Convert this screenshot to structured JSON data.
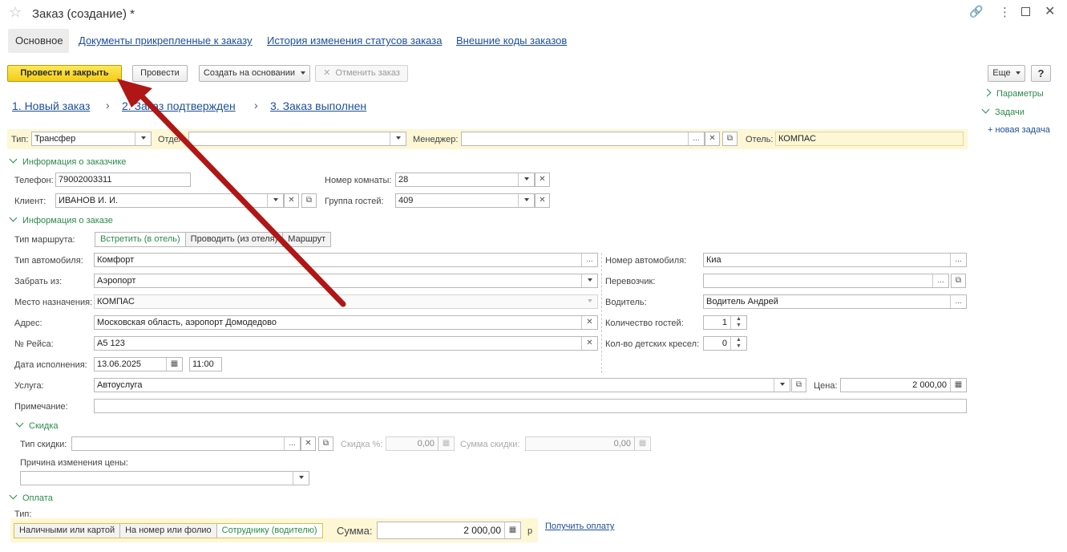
{
  "window": {
    "title": "Заказ (создание) *"
  },
  "tabs": [
    {
      "label": "Основное"
    },
    {
      "label": "Документы прикрепленные к заказу"
    },
    {
      "label": "История изменения статусов заказа"
    },
    {
      "label": "Внешние коды заказов"
    }
  ],
  "toolbar": {
    "post_close": "Провести и закрыть",
    "post": "Провести",
    "create_based": "Создать на основании",
    "cancel_order": "Отменить заказ",
    "more": "Еще",
    "help": "?"
  },
  "steps": [
    "1. Новый заказ",
    "2. Заказ подтвержден",
    "3. Заказ выполнен"
  ],
  "side_panel": {
    "params": "Параметры",
    "tasks": "Задачи",
    "new_task": "+ новая задача"
  },
  "header": {
    "type_label": "Тип:",
    "type_value": "Трансфер",
    "dept_label": "Отдел:",
    "dept_value": "",
    "manager_label": "Менеджер:",
    "manager_value": "",
    "hotel_label": "Отель:",
    "hotel_value": "КОМПАС"
  },
  "customer": {
    "section": "Информация о заказчике",
    "phone_label": "Телефон:",
    "phone_value": "79002003311",
    "client_label": "Клиент:",
    "client_value": "ИВАНОВ И. И.",
    "room_label": "Номер комнаты:",
    "room_value": "28",
    "group_label": "Группа гостей:",
    "group_value": "409"
  },
  "order": {
    "section": "Информация о заказе",
    "route_type_label": "Тип маршрута:",
    "route_options": [
      "Встретить (в отель)",
      "Проводить (из отеля)",
      "Маршрут"
    ],
    "car_type_label": "Тип автомобиля:",
    "car_type_value": "Комфорт",
    "pickup_label": "Забрать из:",
    "pickup_value": "Аэропорт",
    "dest_label": "Место назначения:",
    "dest_value": "КОМПАС",
    "address_label": "Адрес:",
    "address_value": "Московская область, аэропорт Домодедово",
    "flight_label": "№ Рейса:",
    "flight_value": "А5 123",
    "date_label": "Дата исполнения:",
    "date_value": "13.06.2025",
    "time_value": "11:00",
    "car_number_label": "Номер автомобиля:",
    "car_number_value": "Киа",
    "carrier_label": "Перевозчик:",
    "carrier_value": "",
    "driver_label": "Водитель:",
    "driver_value": "Водитель Андрей",
    "guests_label": "Количество гостей:",
    "guests_value": "1",
    "child_seats_label": "Кол-во детских кресел:",
    "child_seats_value": "0",
    "service_label": "Услуга:",
    "service_value": "Автоуслуга",
    "price_label": "Цена:",
    "price_value": "2 000,00",
    "note_label": "Примечание:",
    "note_value": ""
  },
  "discount": {
    "section": "Скидка",
    "type_label": "Тип скидки:",
    "type_value": "",
    "pct_label": "Скидка %:",
    "pct_value": "0,00",
    "sum_label": "Сумма скидки:",
    "sum_value": "0,00",
    "reason_label": "Причина изменения цены:",
    "reason_value": ""
  },
  "payment": {
    "section": "Оплата",
    "type_label": "Тип:",
    "options": [
      "Наличными или картой",
      "На номер или фолио",
      "Сотруднику (водителю)"
    ],
    "sum_label": "Сумма:",
    "sum_value": "2 000,00",
    "currency": "р",
    "get_payment": "Получить оплату"
  },
  "colors": {
    "accent_green": "#2a8a4a",
    "link_blue": "#1d4f9a",
    "primary_yellow": "#f4cd16",
    "highlight_bar": "#fdf7d6",
    "arrow_red": "#b01616"
  }
}
